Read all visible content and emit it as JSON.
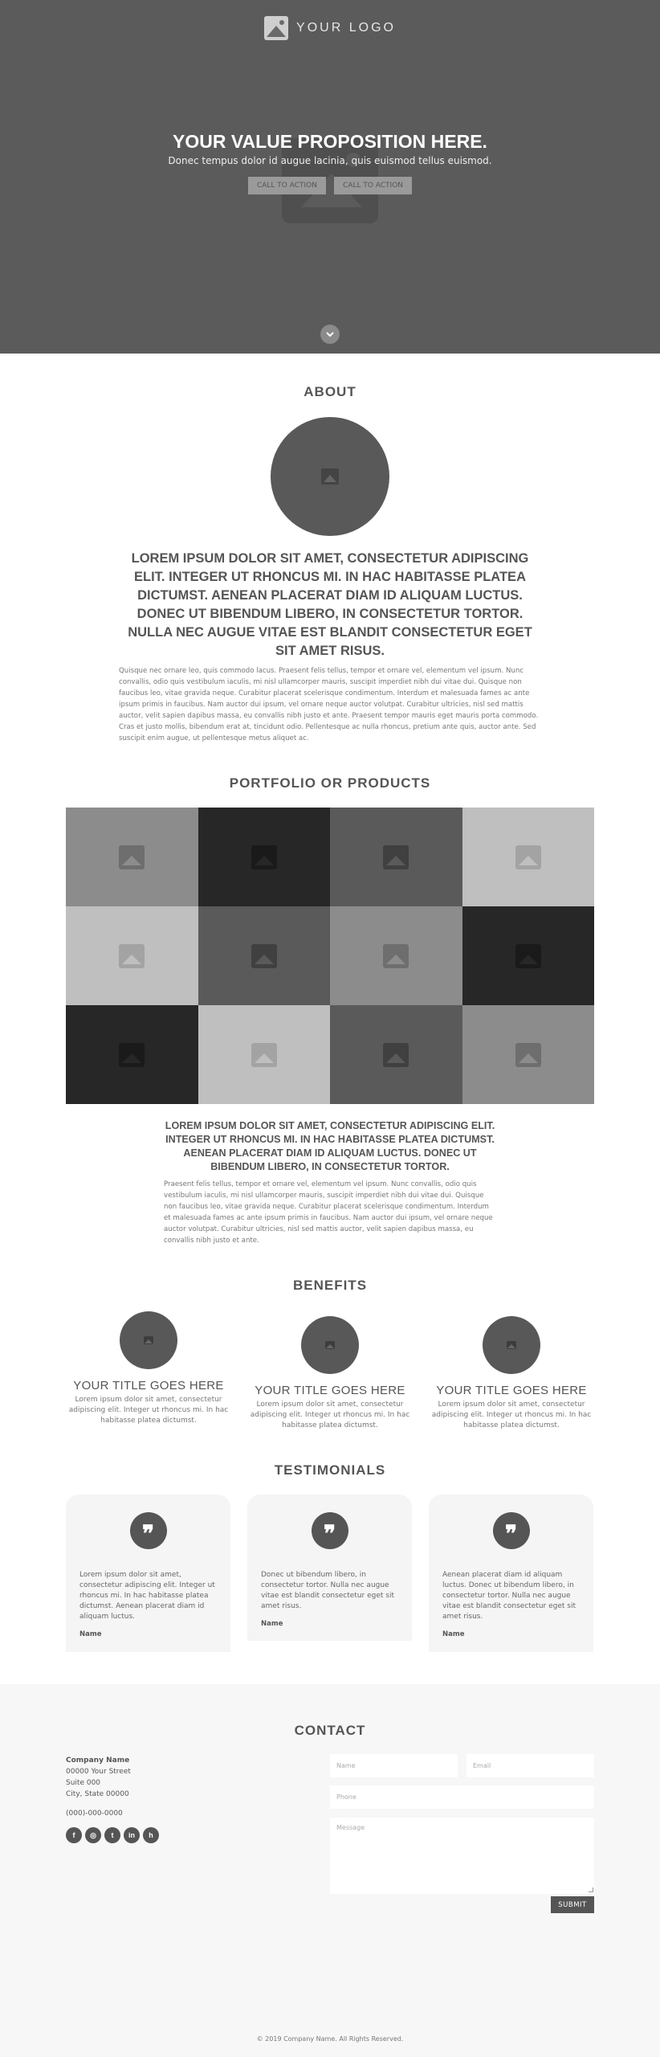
{
  "hero": {
    "logo_text": "YOUR LOGO",
    "title": "YOUR VALUE PROPOSITION HERE.",
    "subtitle": "Donec tempus dolor id augue lacinia, quis euismod tellus euismod.",
    "cta_primary": "CALL TO ACTION",
    "cta_secondary": "CALL TO ACTION",
    "scroll_icon": "chevron-down-icon"
  },
  "about": {
    "title": "ABOUT",
    "heading": "LOREM IPSUM DOLOR SIT AMET, CONSECTETUR ADIPISCING ELIT. INTEGER UT RHONCUS MI. IN HAC HABITASSE PLATEA DICTUMST. AENEAN PLACERAT DIAM ID ALIQUAM LUCTUS. DONEC UT BIBENDUM LIBERO, IN CONSECTETUR TORTOR. NULLA NEC AUGUE VITAE EST BLANDIT CONSECTETUR EGET SIT AMET RISUS.",
    "body": "Quisque nec ornare leo, quis commodo lacus. Praesent felis tellus, tempor et ornare vel, elementum vel ipsum. Nunc convallis, odio quis vestibulum iaculis, mi nisl ullamcorper mauris, suscipit imperdiet nibh dui vitae dui. Quisque non faucibus leo, vitae gravida neque. Curabitur placerat scelerisque condimentum. Interdum et malesuada fames ac ante ipsum primis in faucibus. Nam auctor dui ipsum, vel ornare neque auctor volutpat. Curabitur ultricies, nisl sed mattis auctor, velit sapien dapibus massa, eu convallis nibh justo et ante. Praesent tempor mauris eget mauris porta commodo. Cras et justo mollis, bibendum erat at, tincidunt odio. Pellentesque ac nulla rhoncus, pretium ante quis, auctor ante. Sed suscipit enim augue, ut pellentesque metus aliquet ac."
  },
  "portfolio": {
    "title": "PORTFOLIO OR PRODUCTS",
    "tiles": [
      {
        "bg": "#8c8c8c",
        "icon": "#6e6e6e"
      },
      {
        "bg": "#272727",
        "icon": "#1a1a1a"
      },
      {
        "bg": "#5a5a5a",
        "icon": "#404040"
      },
      {
        "bg": "#bfbfbf",
        "icon": "#a3a3a3"
      },
      {
        "bg": "#bfbfbf",
        "icon": "#a3a3a3"
      },
      {
        "bg": "#5a5a5a",
        "icon": "#404040"
      },
      {
        "bg": "#8c8c8c",
        "icon": "#6e6e6e"
      },
      {
        "bg": "#272727",
        "icon": "#1a1a1a"
      },
      {
        "bg": "#272727",
        "icon": "#1a1a1a"
      },
      {
        "bg": "#bfbfbf",
        "icon": "#a3a3a3"
      },
      {
        "bg": "#5a5a5a",
        "icon": "#404040"
      },
      {
        "bg": "#8c8c8c",
        "icon": "#6e6e6e"
      }
    ],
    "heading": "LOREM IPSUM DOLOR SIT AMET, CONSECTETUR ADIPISCING ELIT. INTEGER UT RHONCUS MI. IN HAC HABITASSE PLATEA DICTUMST. AENEAN PLACERAT DIAM ID ALIQUAM LUCTUS. DONEC UT BIBENDUM LIBERO, IN CONSECTETUR TORTOR.",
    "body": "Praesent felis tellus, tempor et ornare vel, elementum vel ipsum. Nunc convallis, odio quis vestibulum iaculis, mi nisl ullamcorper mauris, suscipit imperdiet nibh dui vitae dui. Quisque non faucibus leo, vitae gravida neque. Curabitur placerat scelerisque condimentum. Interdum et malesuada fames ac ante ipsum primis in faucibus. Nam auctor dui ipsum, vel ornare neque auctor volutpat. Curabitur ultricies, nisl sed mattis auctor, velit sapien dapibus massa, eu convallis nibh justo et ante."
  },
  "benefits": {
    "title": "BENEFITS",
    "items": [
      {
        "title": "YOUR TITLE GOES HERE",
        "text": "Lorem ipsum dolor sit amet, consectetur adipiscing elit. Integer ut rhoncus mi. In hac habitasse platea dictumst."
      },
      {
        "title": "YOUR TITLE GOES HERE",
        "text": "Lorem ipsum dolor sit amet, consectetur adipiscing elit. Integer ut rhoncus mi. In hac habitasse platea dictumst."
      },
      {
        "title": "YOUR TITLE GOES HERE",
        "text": "Lorem ipsum dolor sit amet, consectetur adipiscing elit. Integer ut rhoncus mi. In hac habitasse platea dictumst."
      }
    ]
  },
  "testimonials": {
    "title": "TESTIMONIALS",
    "quote_glyph": "❞",
    "items": [
      {
        "text": "Lorem ipsum dolor sit amet, consectetur adipiscing elit. Integer ut rhoncus mi. In hac habitasse platea dictumst. Aenean placerat diam id aliquam luctus.",
        "name": "Name"
      },
      {
        "text": "Donec ut bibendum libero, in consectetur tortor. Nulla nec augue vitae est blandit consectetur eget sit amet risus.",
        "name": "Name"
      },
      {
        "text": "Aenean placerat diam id aliquam luctus. Donec ut bibendum libero, in consectetur tortor. Nulla nec augue vitae est blandit consectetur eget sit amet risus.",
        "name": "Name"
      }
    ]
  },
  "contact": {
    "title": "CONTACT",
    "company": "Company Name",
    "street": "00000 Your Street",
    "suite": "Suite 000",
    "city": "City, State 00000",
    "phone": "(000)-000-0000",
    "social": [
      {
        "icon": "facebook-icon",
        "glyph": "f"
      },
      {
        "icon": "instagram-icon",
        "glyph": "◎"
      },
      {
        "icon": "twitter-icon",
        "glyph": "t"
      },
      {
        "icon": "linkedin-icon",
        "glyph": "in"
      },
      {
        "icon": "houzz-icon",
        "glyph": "h"
      }
    ],
    "form": {
      "name_placeholder": "Name",
      "email_placeholder": "Email",
      "phone_placeholder": "Phone",
      "message_placeholder": "Message",
      "submit_label": "SUBMIT"
    },
    "copyright": "© 2019 Company Name. All Rights Reserved."
  }
}
